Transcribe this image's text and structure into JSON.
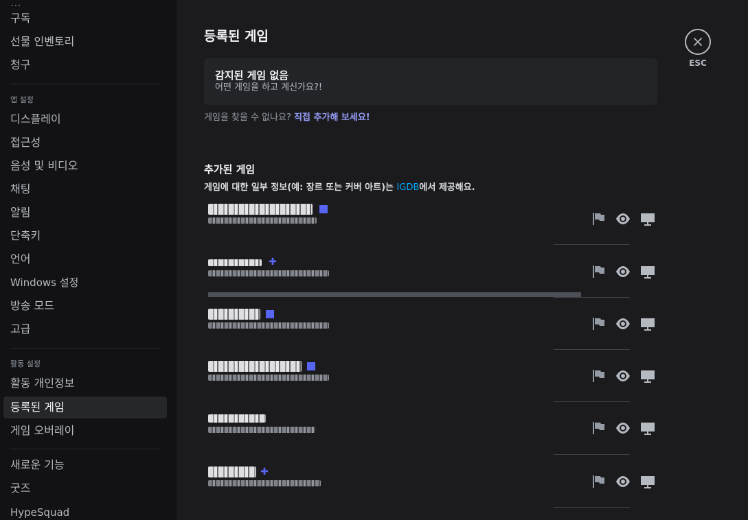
{
  "sidebar": {
    "items_top": [
      {
        "label": "구독"
      },
      {
        "label": "선물 인벤토리"
      },
      {
        "label": "청구"
      }
    ],
    "app_settings_header": "앱 설정",
    "app_settings_items": [
      {
        "label": "디스플레이"
      },
      {
        "label": "접근성"
      },
      {
        "label": "음성 및 비디오"
      },
      {
        "label": "채팅"
      },
      {
        "label": "알림"
      },
      {
        "label": "단축키"
      },
      {
        "label": "언어"
      },
      {
        "label": "Windows 설정"
      },
      {
        "label": "방송 모드"
      },
      {
        "label": "고급"
      }
    ],
    "activity_settings_header": "활동 설정",
    "activity_settings_items": [
      {
        "label": "활동 개인정보"
      },
      {
        "label": "등록된 게임",
        "active": true
      },
      {
        "label": "게임 오버레이"
      }
    ],
    "bottom_items": [
      {
        "label": "새로운 기능"
      },
      {
        "label": "굿즈"
      },
      {
        "label": "HypeSquad"
      }
    ]
  },
  "main": {
    "title": "등록된 게임",
    "no_game_title": "감지된 게임 없음",
    "no_game_sub": "어떤 게임을 하고 계신가요?!",
    "cant_find_prefix": "게임을 찾을 수 없나요?",
    "cant_find_link": "직접 추가해 보세요!",
    "added_games_title": "추가된 게임",
    "igdb_prefix": "게임에 대한 일부 정보(예: 장르 또는 커버 아트)는",
    "igdb_link": "IGDB",
    "igdb_suffix": "에서 제공해요."
  },
  "close": {
    "label": "ESC",
    "icon": "close-icon"
  },
  "games": [
    {
      "verified": true,
      "actions": [
        "flag-icon",
        "eye-icon",
        "monitor-icon"
      ]
    },
    {
      "verified": true,
      "actions": [
        "flag-icon",
        "eye-icon",
        "monitor-icon"
      ]
    },
    {
      "verified": true,
      "actions": [
        "flag-icon",
        "eye-icon",
        "monitor-icon"
      ]
    },
    {
      "verified": true,
      "actions": [
        "flag-icon",
        "eye-icon",
        "monitor-icon"
      ]
    },
    {
      "verified": false,
      "actions": [
        "flag-icon",
        "eye-icon",
        "monitor-icon"
      ]
    },
    {
      "verified": true,
      "actions": [
        "flag-icon",
        "eye-icon",
        "monitor-icon"
      ]
    }
  ],
  "colors": {
    "sidebar_bg": "#121214",
    "content_bg": "#1b1b1e",
    "accent": "#5865f2",
    "link": "#949cf7",
    "igdb_link": "#00a8fc"
  }
}
